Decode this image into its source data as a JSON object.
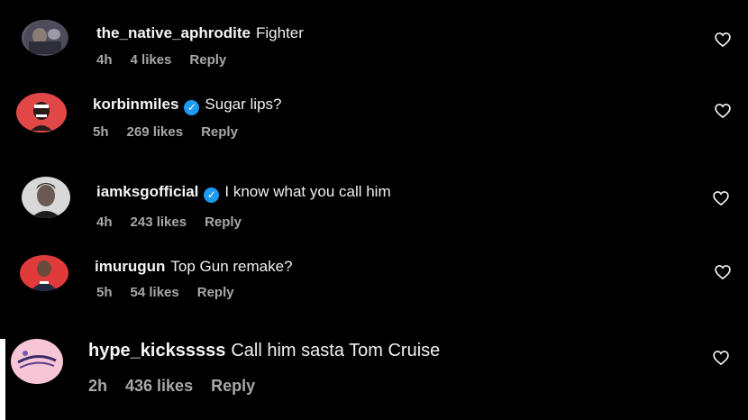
{
  "comments": [
    {
      "username": "the_native_aphrodite",
      "verified": false,
      "text": "Fighter",
      "time": "4h",
      "likes": "4 likes",
      "reply": "Reply"
    },
    {
      "username": "korbinmiles",
      "verified": true,
      "text": "Sugar lips?",
      "time": "5h",
      "likes": "269 likes",
      "reply": "Reply"
    },
    {
      "username": "iamksgofficial",
      "verified": true,
      "text": "I know what you call him",
      "time": "4h",
      "likes": "243 likes",
      "reply": "Reply"
    },
    {
      "username": "imurugun",
      "verified": false,
      "text": "Top Gun remake?",
      "time": "5h",
      "likes": "54 likes",
      "reply": "Reply"
    },
    {
      "username": "hype_kicksssss",
      "verified": false,
      "text": "Call him sasta Tom Cruise",
      "time": "2h",
      "likes": "436 likes",
      "reply": "Reply"
    }
  ],
  "colors": {
    "background": "#000000",
    "username": "#f5f5f5",
    "meta": "#a8a8a8",
    "verified": "#1d9bf0"
  },
  "icons": {
    "like": "heart-outline-icon",
    "verified": "verified-badge-icon"
  }
}
